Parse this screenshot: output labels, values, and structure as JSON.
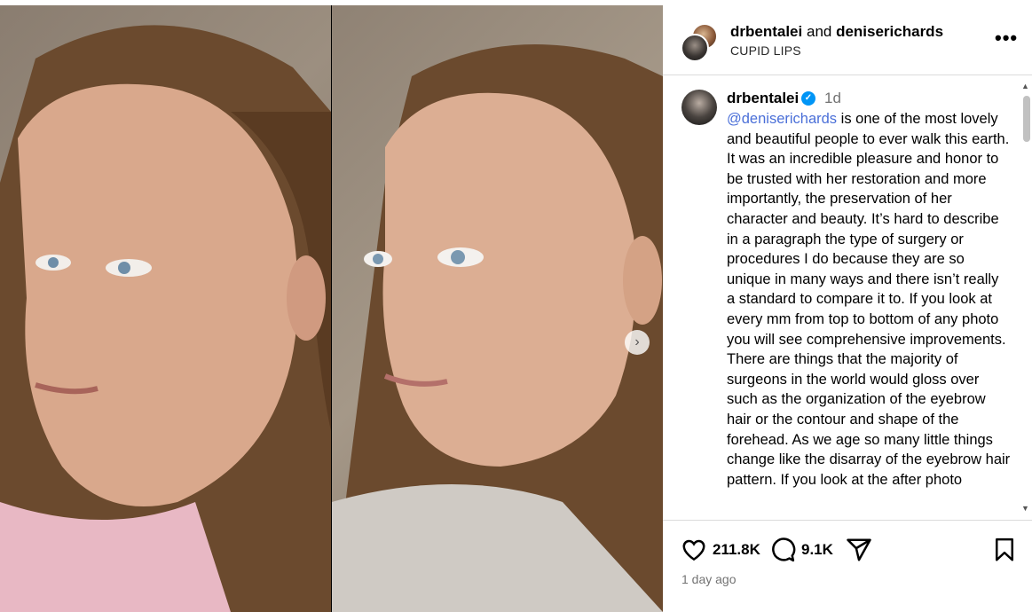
{
  "header": {
    "user1": "drbentalei",
    "joiner": "and",
    "user2": "deniserichards",
    "subtitle": "CUPID LIPS",
    "more_label": "•••"
  },
  "caption": {
    "username": "drbentalei",
    "verified_mark": "✓",
    "time": "1d",
    "mention": "@deniserichards",
    "text": " is one of the most lovely and beautiful people to ever walk this earth. It was an incredible pleasure and honor to be trusted with her restoration and more importantly, the preservation of her character and beauty.  It’s hard to describe in a paragraph the type of surgery or procedures I do because they are so unique in many ways and there isn’t really a standard to compare it to. If you look at every mm from top to bottom of any photo you will see comprehensive improvements.  There are things that the majority of surgeons in the world would gloss over such as the organization of the eyebrow hair or the contour and shape of the forehead. As we age so many little things change like the disarray of the eyebrow hair pattern. If you look at the after photo"
  },
  "actions": {
    "likes": "211.8K",
    "comments": "9.1K",
    "timestamp": "1 day ago"
  },
  "media": {
    "next_glyph": "›"
  },
  "scrollbar": {
    "up_glyph": "▲",
    "down_glyph": "▼"
  },
  "colors": {
    "verified": "#0095f6",
    "mention": "#4a6fd8",
    "muted": "#737373",
    "border": "#dbdbdb"
  }
}
